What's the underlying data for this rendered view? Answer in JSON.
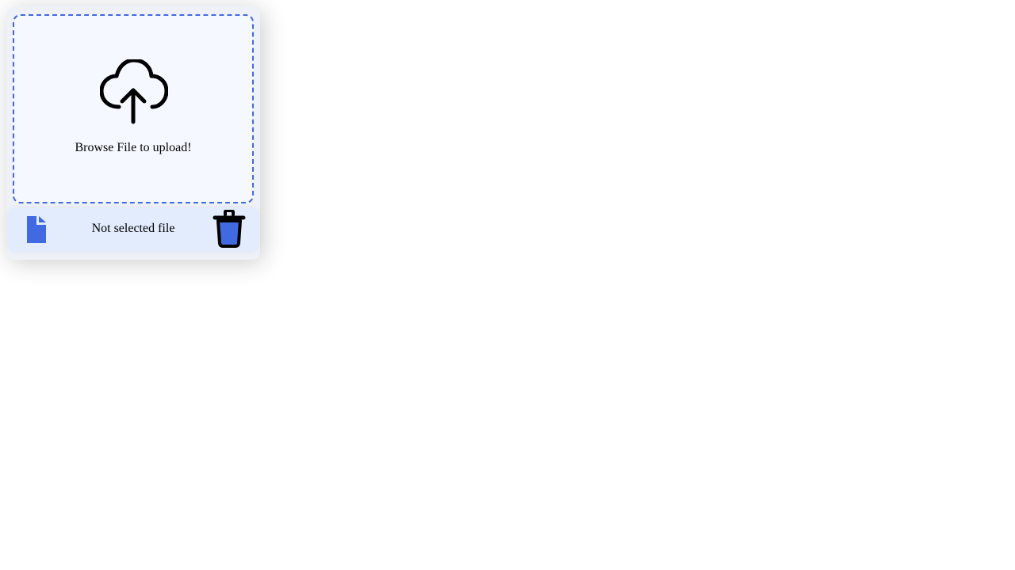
{
  "upload": {
    "prompt": "Browse File to upload!",
    "icon": "cloud-upload-icon"
  },
  "footer": {
    "file_label": "Not selected file",
    "file_icon": "file-icon",
    "delete_icon": "trash-icon"
  },
  "colors": {
    "accent": "#4169e1",
    "drop_zone_bg": "#f5f8fe",
    "footer_bg": "#e2ecfd",
    "card_bg": "#eef1f7"
  }
}
